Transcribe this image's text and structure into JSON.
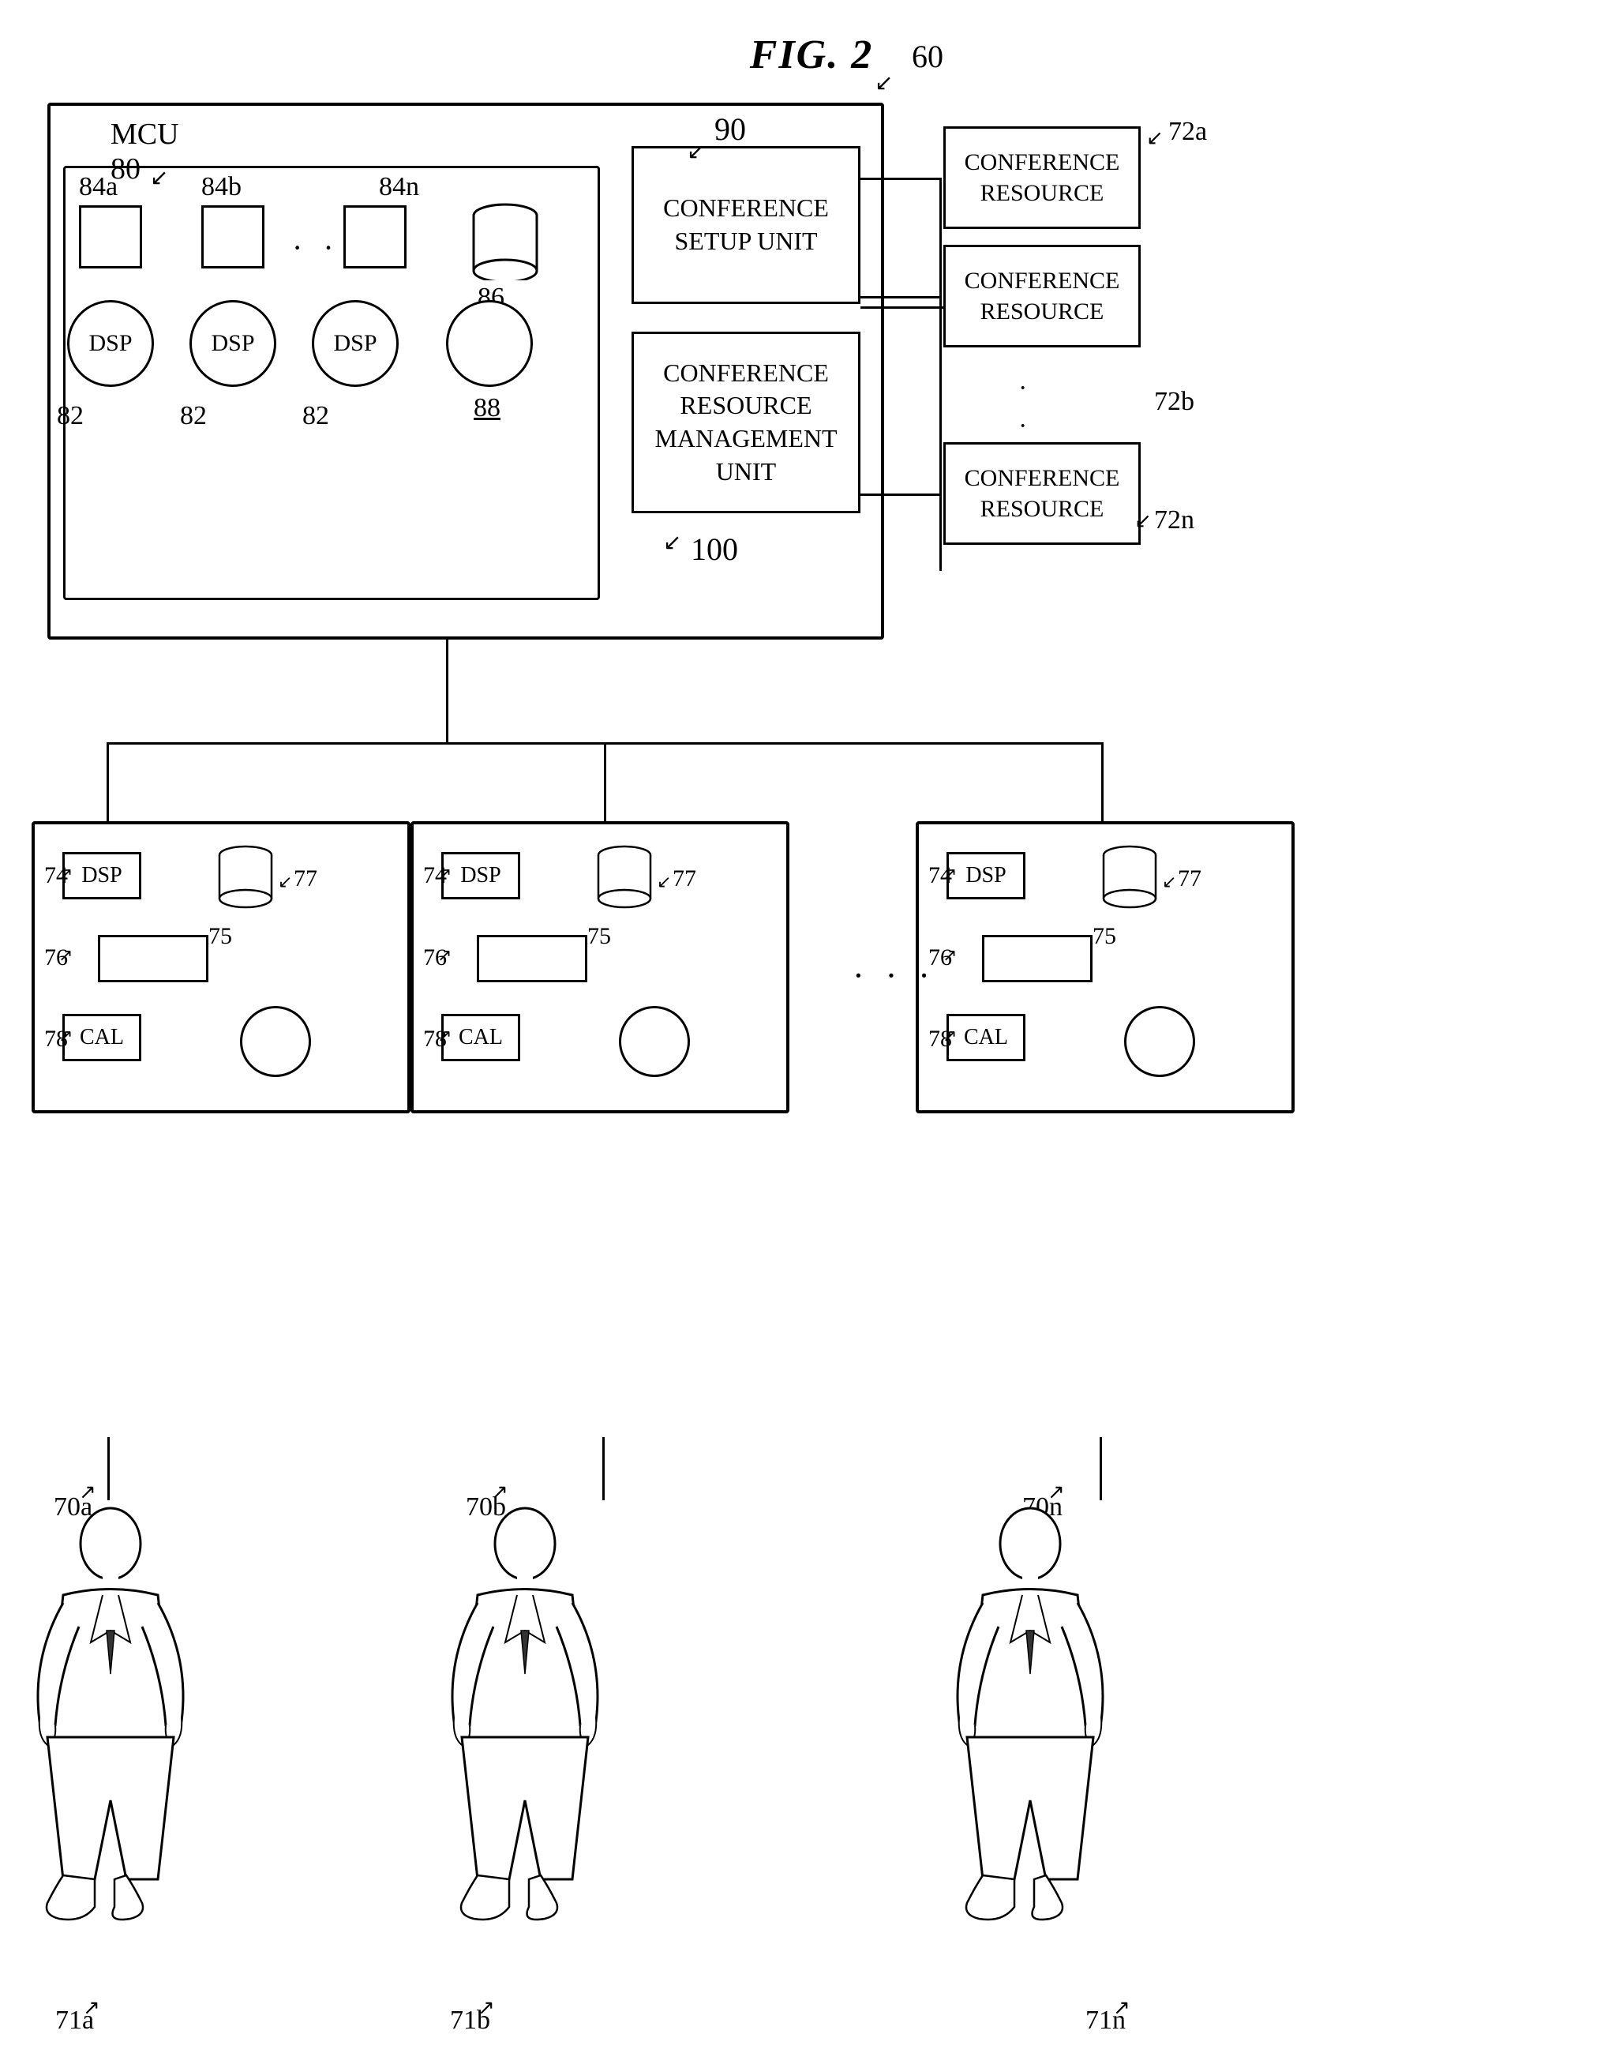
{
  "figure": {
    "title": "FIG. 2",
    "ref_60": "60",
    "mcu_label": "MCU",
    "mcu_ref": "80",
    "ref_90": "90",
    "ref_100": "100",
    "ref_84a": "84a",
    "ref_84b": "84b",
    "ref_84n": "84n",
    "ref_86": "86",
    "ref_88": "88",
    "ref_82a": "82",
    "ref_82b": "82",
    "ref_82c": "82",
    "ref_72a": "72a",
    "ref_72b": "72b",
    "ref_72n": "72n",
    "setup_unit_label": "CONFERENCE SETUP UNIT",
    "mgmt_unit_label": "CONFERENCE RESOURCE MANAGEMENT UNIT",
    "conf_res_1": "CONFERENCE RESOURCE",
    "conf_res_2": "CONFERENCE RESOURCE",
    "conf_res_3": "CONFERENCE RESOURCE",
    "dsp_label": "DSP",
    "cal_label": "CAL",
    "ref_74": "74",
    "ref_75": "75",
    "ref_76": "76",
    "ref_77": "77",
    "ref_78": "78",
    "ref_70a": "70a",
    "ref_70b": "70b",
    "ref_70n": "70n",
    "ref_71a": "71a",
    "ref_71b": "71b",
    "ref_71n": "71n",
    "dots": "· · ·"
  }
}
